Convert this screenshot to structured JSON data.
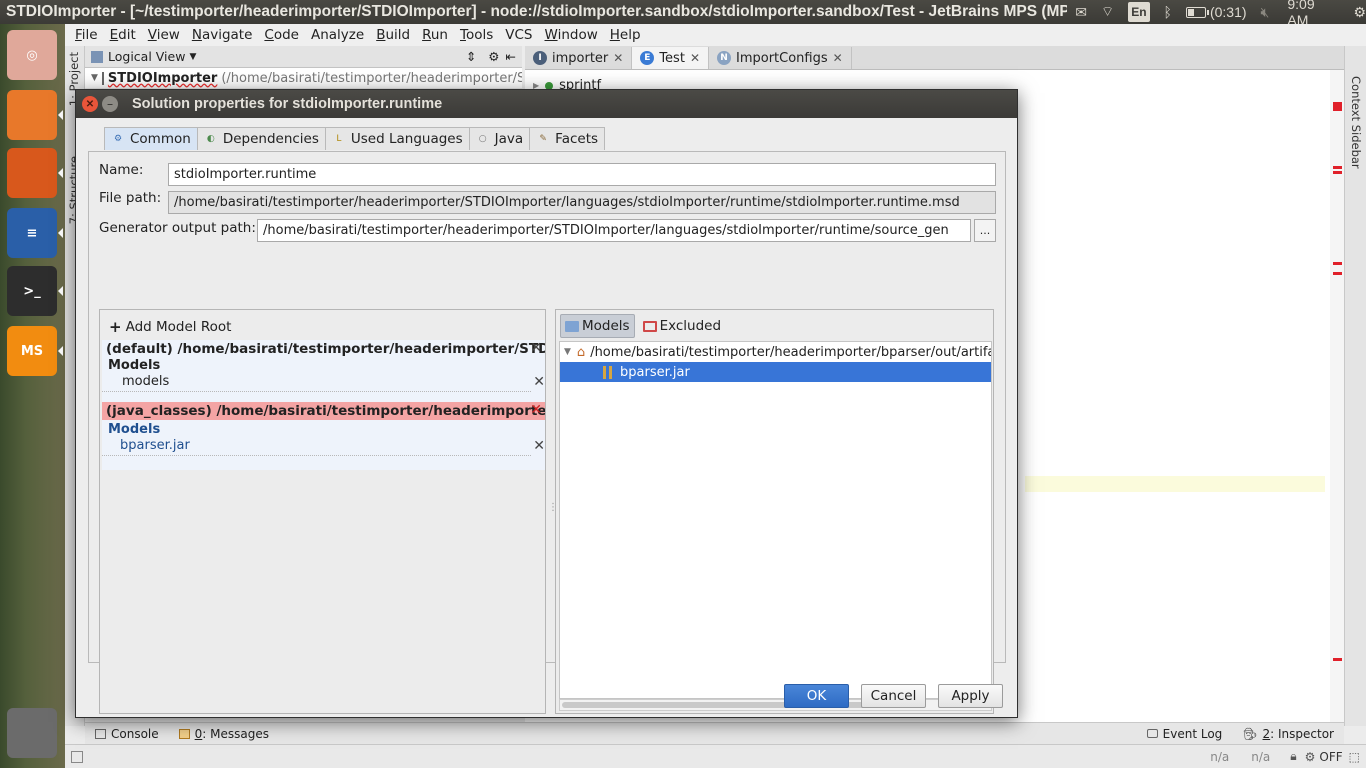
{
  "top_panel": {
    "window_title": "STDIOImporter - [~/testimporter/headerimporter/STDIOImporter] - node://stdioImporter.sandbox/stdioImporter.sandbox/Test - JetBrains MPS (MPS",
    "keyboard_layout": "En",
    "battery_time": "(0:31)",
    "battery_level": 0.35,
    "clock": "9:09 AM"
  },
  "launcher": {
    "items": [
      {
        "name": "dash-icon",
        "glyph": "◎",
        "color": "#e0a89a"
      },
      {
        "name": "files-icon",
        "glyph": "",
        "color": "#e8782a"
      },
      {
        "name": "firefox-icon",
        "glyph": "",
        "color": "#d8581c"
      },
      {
        "name": "writer-icon",
        "glyph": "≡",
        "color": "#2a5fa8"
      },
      {
        "name": "terminal-icon",
        "glyph": ">_",
        "color": "#2d2d2d"
      },
      {
        "name": "mps-icon",
        "glyph": "MS",
        "color": "#f28c10"
      },
      {
        "name": "trash-icon",
        "glyph": "",
        "color": "#6b6b6b"
      }
    ]
  },
  "menu": {
    "items": [
      {
        "underline": "F",
        "rest": "ile"
      },
      {
        "underline": "E",
        "rest": "dit"
      },
      {
        "underline": "V",
        "rest": "iew"
      },
      {
        "underline": "N",
        "rest": "avigate"
      },
      {
        "underline": "C",
        "rest": "ode"
      },
      {
        "underline": "",
        "rest": "Analyze"
      },
      {
        "underline": "B",
        "rest": "uild"
      },
      {
        "underline": "R",
        "rest": "un"
      },
      {
        "underline": "T",
        "rest": "ools"
      },
      {
        "underline": "",
        "rest": "VCS"
      },
      {
        "underline": "W",
        "rest": "indow"
      },
      {
        "underline": "H",
        "rest": "elp"
      }
    ]
  },
  "ide": {
    "project_tab": "1: Project",
    "structure_tab": "7: Structure",
    "view_selector": "Logical View",
    "project_root": "STDIOImporter",
    "project_root_path": "(/home/basirati/testimporter/headerimporter/S",
    "editor_tabs": [
      {
        "label": "importer",
        "icon": "I",
        "icon_color": "#4b5f7a",
        "active": false
      },
      {
        "label": "Test",
        "icon": "E",
        "icon_color": "#3a7bd5",
        "active": true
      },
      {
        "label": "ImportConfigs",
        "icon": "N",
        "icon_color": "#8aa3c2",
        "active": false
      }
    ],
    "editor_snippet": "sprintf",
    "context_sidebar": "Context Sidebar",
    "bottom_tools": {
      "console": "Console",
      "messages_num": "0",
      "messages": ": Messages",
      "event_log": "Event Log",
      "inspector_num": "2",
      "inspector": ": Inspector"
    },
    "status": {
      "na1": "n/a",
      "na2": "n/a",
      "off": "OFF"
    }
  },
  "dialog": {
    "title": "Solution properties for stdioImporter.runtime",
    "tabs": [
      {
        "label": "Common",
        "icon": "⚙",
        "active": true
      },
      {
        "label": "Dependencies",
        "icon": "◐",
        "active": false
      },
      {
        "label": "Used Languages",
        "icon": "L",
        "active": false
      },
      {
        "label": "Java",
        "icon": "○",
        "active": false
      },
      {
        "label": "Facets",
        "icon": "✎",
        "active": false
      }
    ],
    "name_label": "Name:",
    "name_value": "stdioImporter.runtime",
    "filepath_label": "File path:",
    "filepath_value": "/home/basirati/testimporter/headerimporter/STDIOImporter/languages/stdioImporter/runtime/stdioImporter.runtime.msd",
    "genpath_label": "Generator output path:",
    "genpath_value": "/home/basirati/testimporter/headerimporter/STDIOImporter/languages/stdioImporter/runtime/source_gen",
    "browse_label": "...",
    "add_model_root": "Add Model Root",
    "roots": [
      {
        "header": "(default) /home/basirati/testimporter/headerimporter/STDI...",
        "error": false,
        "models_label": "Models",
        "entry": "models"
      },
      {
        "header": "(java_classes) /home/basirati/testimporter/headerimporte...",
        "error": true,
        "models_label": "Models",
        "entry": "bparser.jar"
      }
    ],
    "tree_toolbar": {
      "models": "Models",
      "excluded": "Excluded"
    },
    "tree": {
      "root_path": "/home/basirati/testimporter/headerimporter/bparser/out/artifac",
      "child": "bparser.jar"
    },
    "buttons": {
      "ok": "OK",
      "cancel": "Cancel",
      "apply": "Apply"
    }
  }
}
